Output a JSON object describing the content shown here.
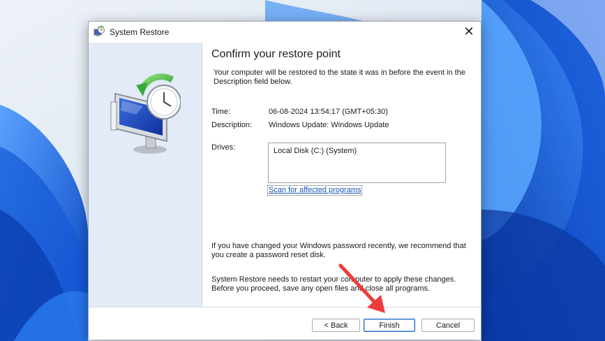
{
  "window": {
    "title": "System Restore",
    "close_glyph": "✕"
  },
  "main": {
    "heading": "Confirm your restore point",
    "intro": "Your computer will be restored to the state it was in before the event in the Description field below.",
    "time_label": "Time:",
    "time_value": "06-08-2024 13:54:17 (GMT+05:30)",
    "description_label": "Description:",
    "description_value": "Windows Update: Windows Update",
    "drives_label": "Drives:",
    "drives": [
      "Local Disk (C:) (System)"
    ],
    "scan_link": "Scan for affected programs",
    "password_note": "If you have changed your Windows password recently, we recommend that you create a password reset disk.",
    "restart_note": "System Restore needs to restart your computer to apply these changes. Before you proceed, save any open files and close all programs."
  },
  "footer": {
    "back_label": "< Back",
    "finish_label": "Finish",
    "cancel_label": "Cancel"
  },
  "icons": {
    "title": "system-restore-icon",
    "hero": "restore-computer-clock-icon",
    "close": "close-icon",
    "annotation": "red-arrow-annotation"
  },
  "colors": {
    "link": "#1a56b5",
    "left_panel": "#e2ebf7",
    "annotation_arrow": "#ee3b3b",
    "wallpaper_blue": "#1e6fe0"
  }
}
